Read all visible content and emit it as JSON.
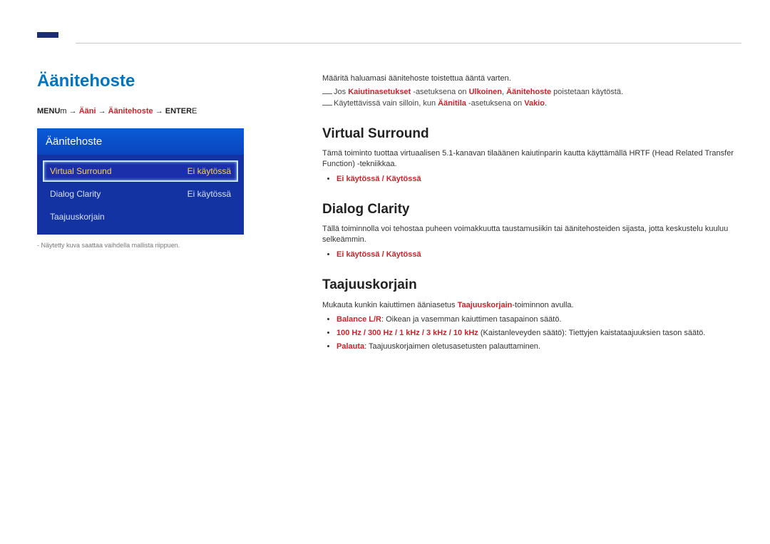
{
  "header": {},
  "left": {
    "title": "Äänitehoste",
    "breadcrumb": {
      "menu": "MENU",
      "m": "m",
      "arrow": " → ",
      "seg1": "Ääni",
      "seg2": "Äänitehoste",
      "enter": "ENTER",
      "e": "E"
    },
    "panel": {
      "header": "Äänitehoste",
      "rows": [
        {
          "label": "Virtual Surround",
          "value": "Ei käytössä",
          "selected": true
        },
        {
          "label": "Dialog Clarity",
          "value": "Ei käytössä",
          "selected": false
        },
        {
          "label": "Taajuuskorjain",
          "value": "",
          "selected": false
        }
      ]
    },
    "footnote_dash": "-",
    "footnote": "Näytetty kuva saattaa vaihdella mallista riippuen."
  },
  "right": {
    "intro": "Määritä haluamasi äänitehoste toistettua ääntä varten.",
    "note1": {
      "pre": "Jos ",
      "k1": "Kaiutinasetukset",
      "mid1": " -asetuksena on ",
      "k2": "Ulkoinen",
      "sep": ", ",
      "k3": "Äänitehoste",
      "post": " poistetaan käytöstä."
    },
    "note2": {
      "pre": "Käytettävissä vain silloin, kun ",
      "k1": "Äänitila",
      "mid": " -asetuksena on ",
      "k2": "Vakio",
      "post": "."
    },
    "vs": {
      "heading": "Virtual Surround",
      "para": "Tämä toiminto tuottaa virtuaalisen 5.1-kanavan tilaäänen kaiutinparin kautta käyttämällä HRTF (Head Related Transfer Function) -tekniikkaa.",
      "opt_off": "Ei käytössä",
      "opt_on": "Käytössä",
      "slash": " / "
    },
    "dc": {
      "heading": "Dialog Clarity",
      "para": "Tällä toiminnolla voi tehostaa puheen voimakkuutta taustamusiikin tai äänitehosteiden sijasta, jotta keskustelu kuuluu selkeämmin.",
      "opt_off": "Ei käytössä",
      "opt_on": "Käytössä",
      "slash": " / "
    },
    "eq": {
      "heading": "Taajuuskorjain",
      "para_pre": "Mukauta kunkin kaiuttimen ääniasetus ",
      "para_key": "Taajuuskorjain",
      "para_post": "-toiminnon avulla.",
      "balance_key": "Balance L/R",
      "balance_txt": ": Oikean ja vasemman kaiuttimen tasapainon säätö.",
      "freq": {
        "f1": "100 Hz",
        "f2": "300 Hz",
        "f3": "1 kHz",
        "f4": "3 kHz",
        "f5": "10 kHz",
        "slash": " / ",
        "txt": " (Kaistanleveyden säätö): Tiettyjen kaistataajuuksien tason säätö."
      },
      "reset_key": "Palauta",
      "reset_txt": ": Taajuuskorjaimen oletusasetusten palauttaminen."
    }
  }
}
